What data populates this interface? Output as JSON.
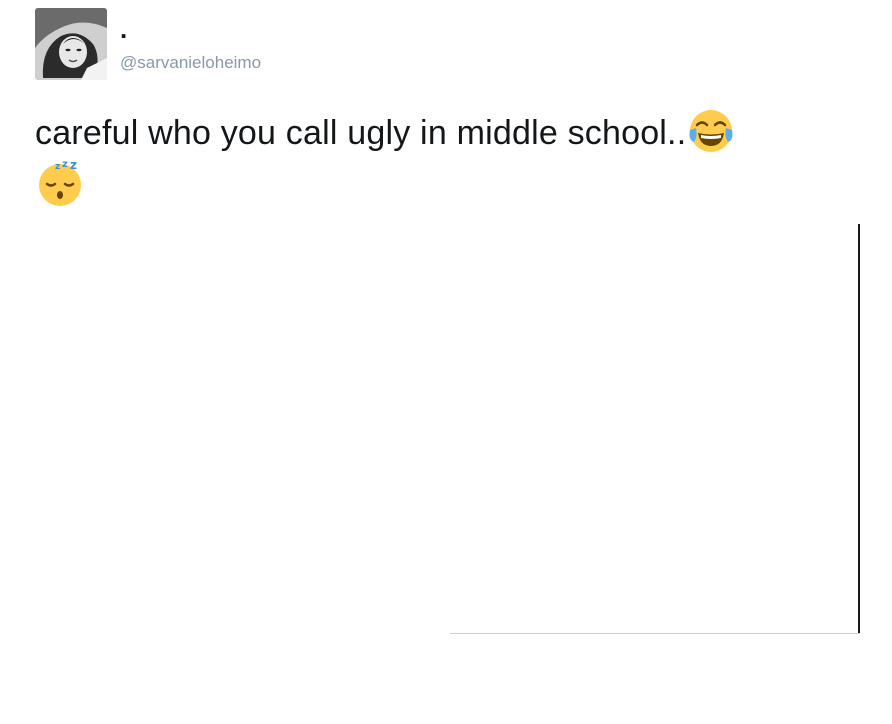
{
  "tweet": {
    "display_name": ".",
    "handle": "@sarvanieloheimo",
    "text": "careful who you call ugly in middle school..",
    "emojis": [
      "face-with-tears-of-joy-icon",
      "sleeping-face-icon"
    ]
  },
  "colors": {
    "text": "#14171a",
    "handle": "#8899a6",
    "emoji_face": "#ffcc4d"
  }
}
